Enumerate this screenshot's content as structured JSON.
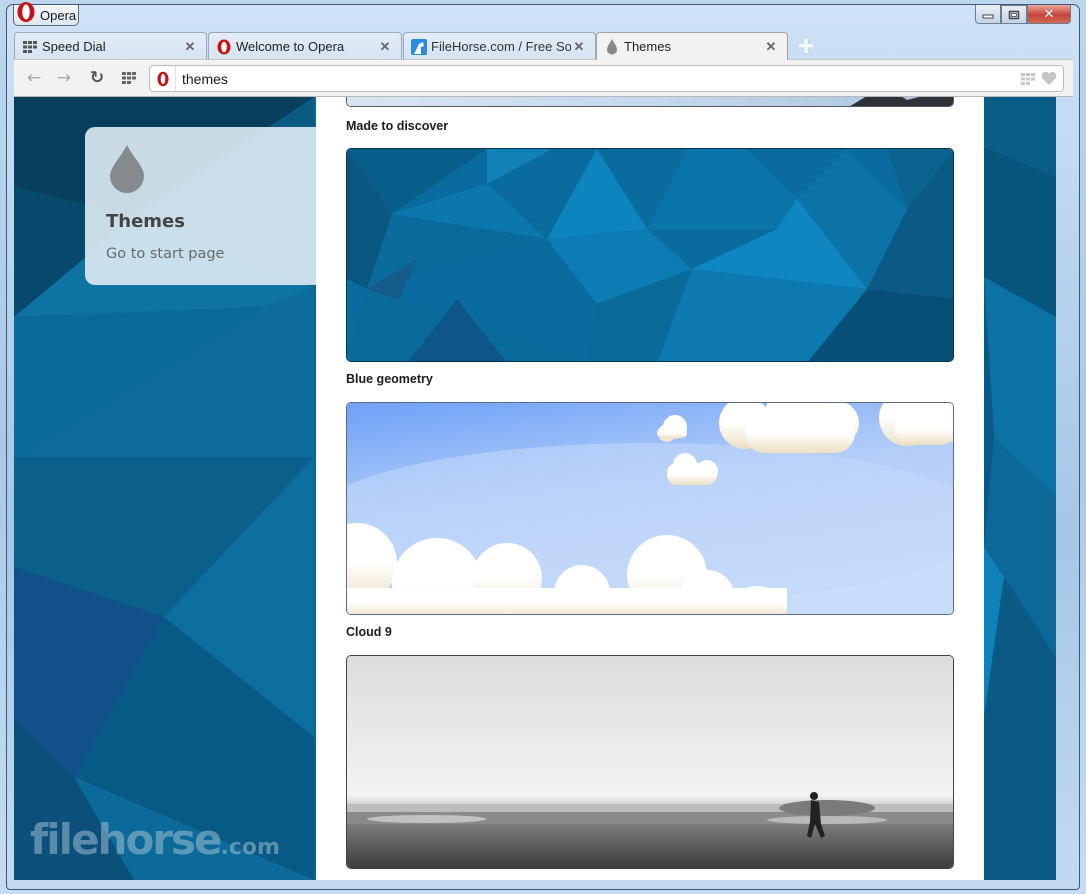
{
  "window": {
    "app_menu_label": "Opera",
    "controls": {
      "minimize": "—",
      "maximize": "▫",
      "close": "✕"
    }
  },
  "tabs": [
    {
      "label": "Speed Dial",
      "icon": "speed-dial-icon",
      "active": false
    },
    {
      "label": "Welcome to Opera",
      "icon": "opera-logo-icon",
      "active": false
    },
    {
      "label": "FileHorse.com / Free Softw",
      "icon": "filehorse-icon",
      "active": false
    },
    {
      "label": "Themes",
      "icon": "drop-icon",
      "active": true
    }
  ],
  "tab_close_glyph": "✕",
  "new_tab_glyph": "✚",
  "toolbar": {
    "back_glyph": "←",
    "forward_glyph": "→",
    "reload_glyph": "↻",
    "address_value": "themes"
  },
  "sidebar": {
    "title": "Themes",
    "link": "Go to start page"
  },
  "themes": [
    {
      "name": "Made to discover"
    },
    {
      "name": "Blue geometry"
    },
    {
      "name": "Cloud 9"
    },
    {
      "name": ""
    }
  ],
  "watermark": {
    "text": "filehorse",
    "suffix": ".com"
  },
  "colors": {
    "opera_red": "#cc0f16",
    "page_bg_blue": "#0a5d87",
    "drop_gray": "#858a8e"
  }
}
